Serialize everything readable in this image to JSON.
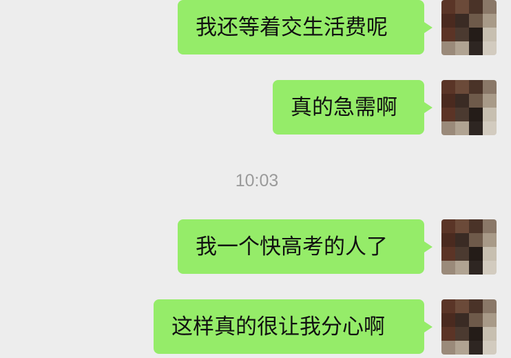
{
  "chat": {
    "messages": [
      {
        "text": "我还等着交生活费呢"
      },
      {
        "text": "真的急需啊"
      },
      {
        "text": "我一个快高考的人了"
      },
      {
        "text": "这样真的很让我分心啊"
      }
    ],
    "timestamp": "10:03"
  },
  "colors": {
    "background": "#ededed",
    "bubble": "#95ec69",
    "timestamp": "#9a9a9a"
  },
  "avatar": {
    "icon": "pixelated-avatar-icon"
  }
}
